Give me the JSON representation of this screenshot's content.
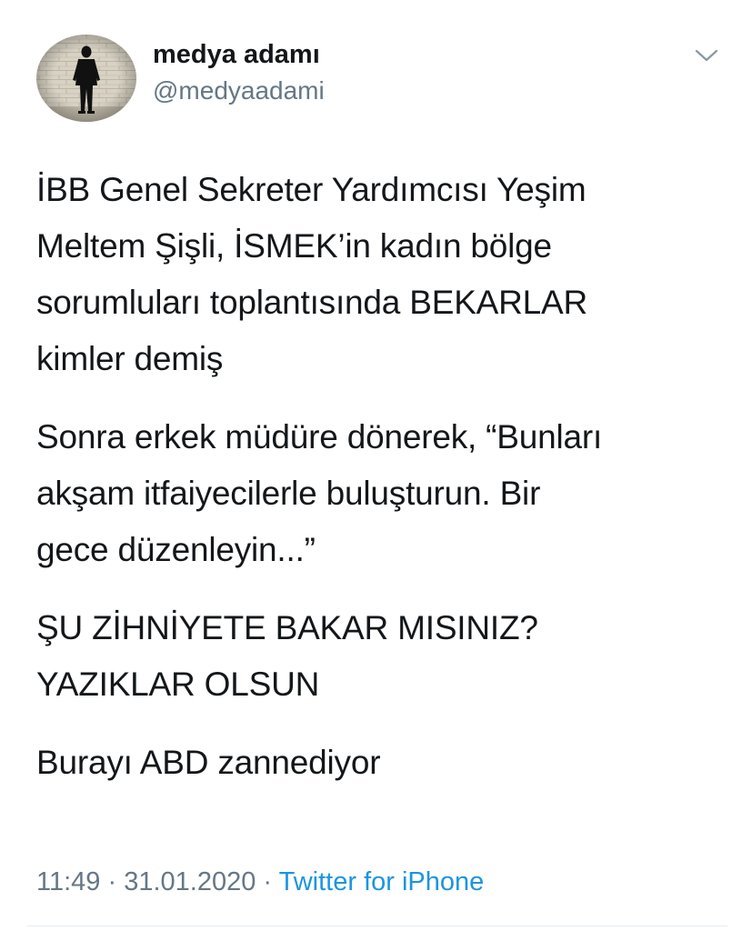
{
  "user": {
    "display_name": "medya adamı",
    "handle": "@medyaadami",
    "avatar_icon": "man-silhouette-avatar"
  },
  "menu": {
    "icon": "chevron-down-icon"
  },
  "tweet": {
    "paragraphs": [
      "İBB Genel Sekreter Yardımcısı Yeşim\nMeltem Şişli, İSMEK’in kadın bölge\nsorumluları toplantısında BEKARLAR\nkimler demiş",
      "Sonra erkek müdüre dönerek, “Bunları\nakşam itfaiyecilerle buluşturun. Bir\ngece düzenleyin...”",
      "ŞU ZİHNİYETE BAKAR MISINIZ?\nYAZIKLAR OLSUN",
      "Burayı ABD zannediyor"
    ]
  },
  "meta": {
    "time": "11:49",
    "separator": " · ",
    "date": "31.01.2020",
    "source": "Twitter for iPhone"
  },
  "colors": {
    "text": "#14171a",
    "secondary": "#657786",
    "link": "#1b95e0"
  }
}
